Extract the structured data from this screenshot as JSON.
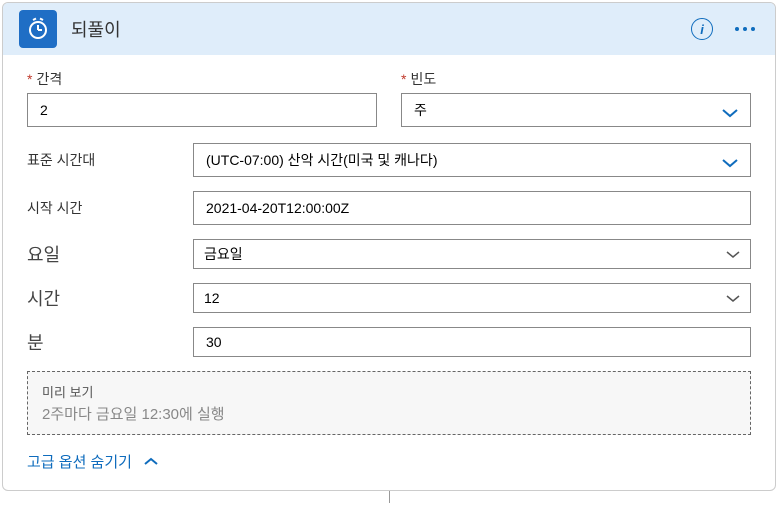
{
  "header": {
    "title": "되풀이"
  },
  "fields": {
    "interval": {
      "label": "간격",
      "value": "2"
    },
    "frequency": {
      "label": "빈도",
      "value": "주"
    },
    "timezone": {
      "label": "표준 시간대",
      "value": "(UTC-07:00) 산악 시간(미국 및  캐나다)"
    },
    "startTime": {
      "label": "시작 시간",
      "value": "2021-04-20T12:00:00Z"
    },
    "days": {
      "label": "요일",
      "value": "금요일"
    },
    "hours": {
      "label": "시간",
      "value": "12"
    },
    "minutes": {
      "label": "분",
      "value": "30"
    }
  },
  "preview": {
    "title": "미리 보기",
    "text": "2주마다 금요일 12:30에 실행"
  },
  "hideAdvanced": "고급 옵션 숨기기"
}
